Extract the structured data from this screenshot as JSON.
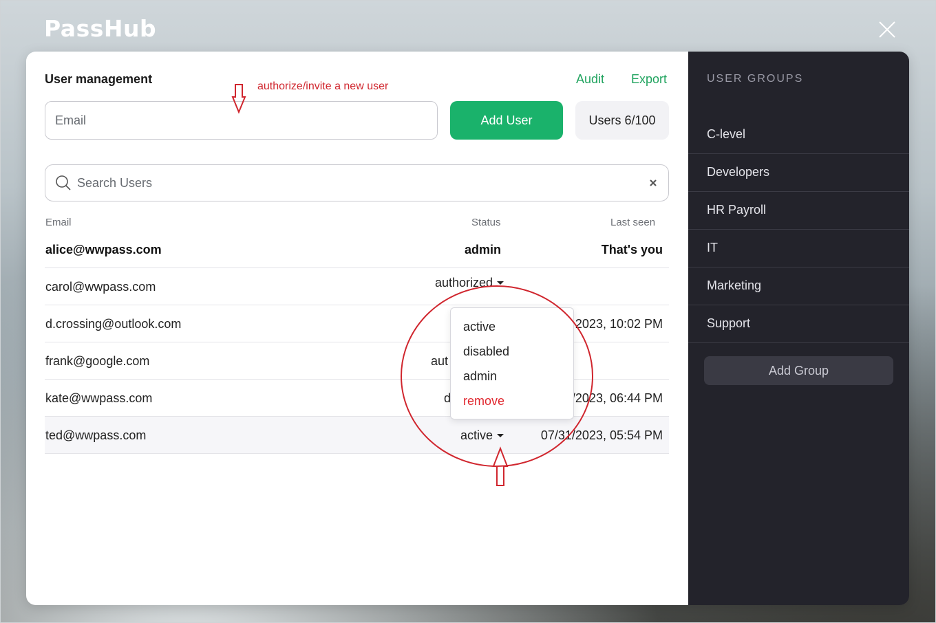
{
  "app": {
    "logo": "PassHub"
  },
  "header": {
    "title": "User management",
    "audit_label": "Audit",
    "export_label": "Export"
  },
  "invite": {
    "email_placeholder": "Email",
    "add_user_label": "Add User",
    "users_count": "Users 6/100"
  },
  "search": {
    "placeholder": "Search Users"
  },
  "table": {
    "headers": {
      "email": "Email",
      "status": "Status",
      "last_seen": "Last seen"
    },
    "rows": [
      {
        "email": "alice@wwpass.com",
        "status": "admin",
        "last_seen": "That's you"
      },
      {
        "email": "carol@wwpass.com",
        "status": "authorized",
        "last_seen": ""
      },
      {
        "email": "d.crossing@outlook.com",
        "status": "",
        "last_seen": "2023, 10:02 PM"
      },
      {
        "email": "frank@google.com",
        "status": "aut",
        "last_seen": ""
      },
      {
        "email": "kate@wwpass.com",
        "status": "d",
        "last_seen": "/2023, 06:44 PM"
      },
      {
        "email": "ted@wwpass.com",
        "status": "active",
        "last_seen": "07/31/2023, 05:54 PM"
      }
    ]
  },
  "status_menu": {
    "options": [
      "active",
      "disabled",
      "admin",
      "remove"
    ]
  },
  "annotation": {
    "text": "authorize/invite a new user",
    "color": "#d0262e"
  },
  "sidebar": {
    "title": "USER GROUPS",
    "groups": [
      "C-level",
      "Developers",
      "HR Payroll",
      "IT",
      "Marketing",
      "Support"
    ],
    "add_group_label": "Add Group"
  },
  "colors": {
    "accent_green": "#1ab26b",
    "link_green": "#1fa35e",
    "sidebar_bg": "#23232b",
    "remove_red": "#e0262d"
  }
}
